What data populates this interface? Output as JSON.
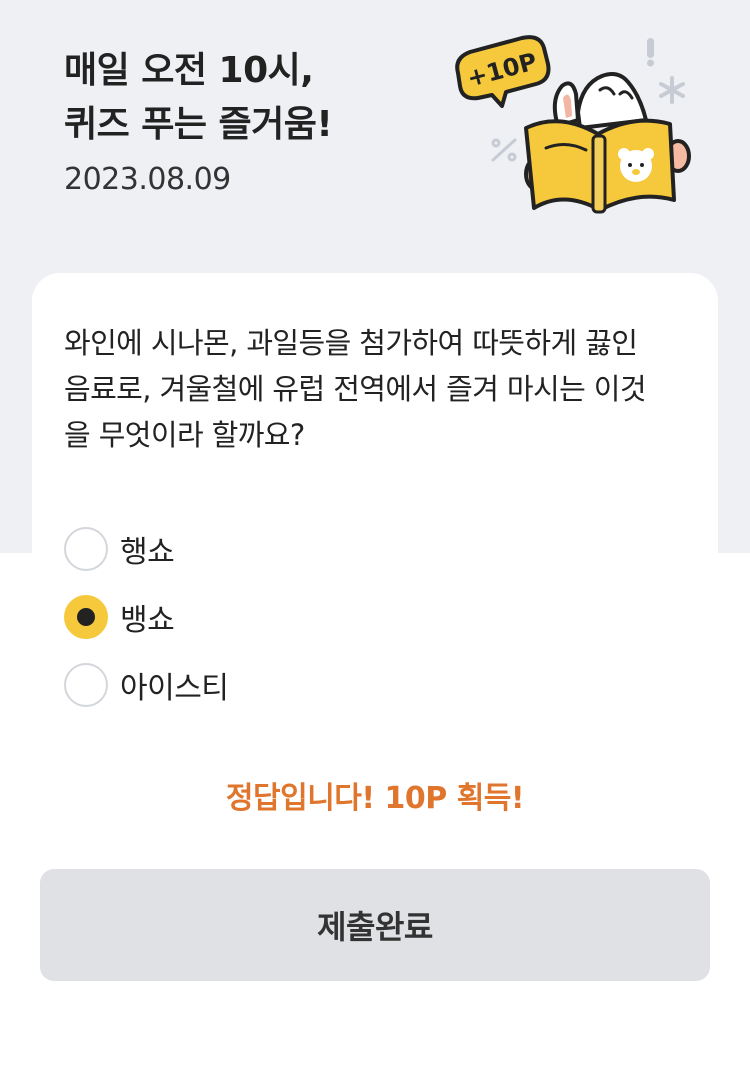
{
  "header": {
    "title_line1": "매일 오전 10시,",
    "title_line2": "퀴즈 푸는 즐거움!",
    "date": "2023.08.09",
    "badge_text": "+10P"
  },
  "quiz": {
    "question_lines": [
      "와인에 시나몬, 과일등을 첨가하여 따뜻하게 끓인",
      "음료로, 겨울철에 유럽 전역에서 즐겨 마시는 이것",
      "을 무엇이라 할까요?"
    ],
    "options": [
      {
        "label": "행쇼",
        "selected": false
      },
      {
        "label": "뱅쇼",
        "selected": true
      },
      {
        "label": "아이스티",
        "selected": false
      }
    ],
    "result_text": "정답입니다! 10P 획득!"
  },
  "submit": {
    "label": "제출완료"
  },
  "colors": {
    "header_background": "#eef0f4",
    "accent_yellow": "#f6c93c",
    "result_orange": "#e0762d",
    "button_background": "#dfe1e4"
  },
  "icons": {
    "illustration": "rabbit-reading-book-illustration",
    "badge": "speech-bubble-badge"
  }
}
